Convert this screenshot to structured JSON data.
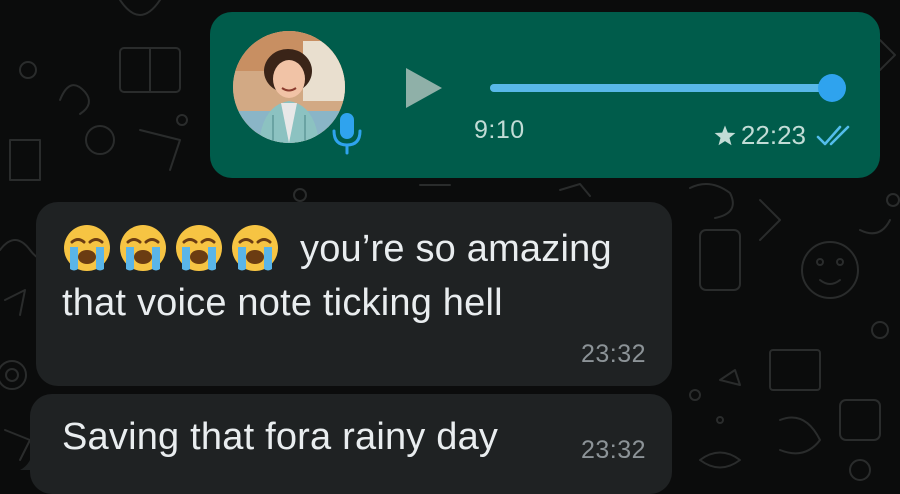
{
  "voice_note": {
    "duration": "9:10",
    "timestamp": "22:23",
    "starred": true,
    "read_receipt": "double-check-blue",
    "progress": 1.0,
    "icons": {
      "play": "play-icon",
      "mic": "mic-icon",
      "star": "star-icon",
      "ticks": "double-check-icon"
    }
  },
  "messages": [
    {
      "direction": "incoming",
      "emoji": [
        "😭",
        "😭",
        "😭",
        "😭"
      ],
      "line1": "you’re so amazing",
      "line2": "that voice note ticking hell",
      "time": "23:32"
    },
    {
      "direction": "incoming",
      "line1": "Saving that fora rainy day",
      "time": "23:32"
    }
  ],
  "colors": {
    "background": "#0b0c0c",
    "outgoing_bubble": "#005c4b",
    "incoming_bubble": "#1f2223",
    "accent_blue": "#2fa3ee",
    "text_primary": "#e9edef",
    "text_meta": "#8c9397"
  }
}
